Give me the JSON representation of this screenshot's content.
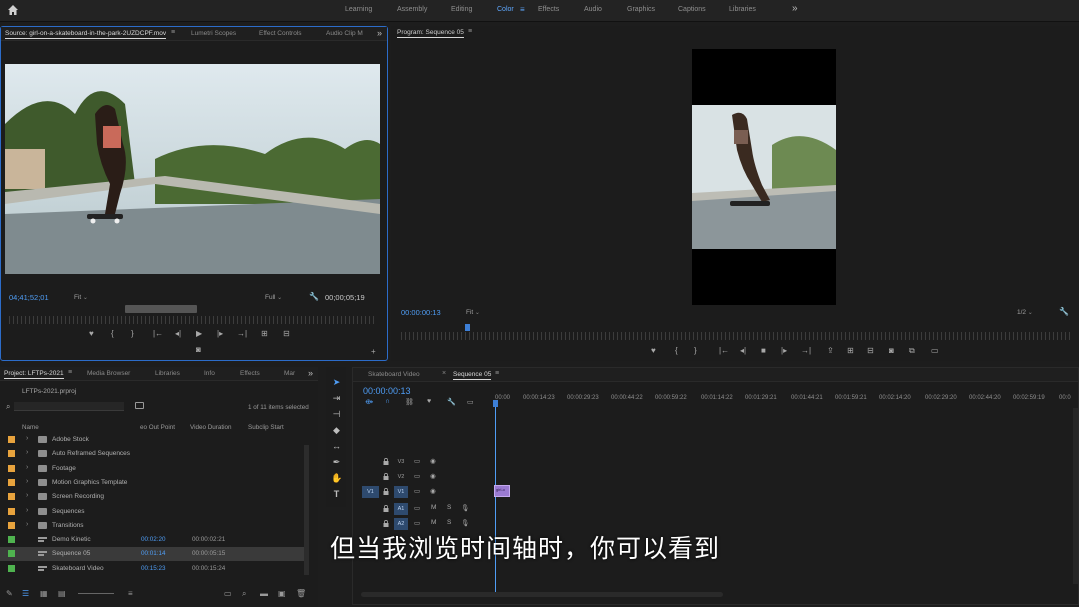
{
  "workspaces": {
    "tabs": [
      "Learning",
      "Assembly",
      "Editing",
      "Color",
      "Effects",
      "Audio",
      "Graphics",
      "Captions",
      "Libraries"
    ],
    "active": "Color",
    "more": "»"
  },
  "source": {
    "tabs": [
      "Source: girl-on-a-skateboard-in-the-park-2UZDCPF.mov",
      "Lumetri Scopes",
      "Effect Controls",
      "Audio Clip M"
    ],
    "timecode": "04;41;52;01",
    "fit": "Fit",
    "resolution": "Full",
    "duration": "00;00;05;19"
  },
  "program": {
    "tab": "Program: Sequence 05",
    "timecode": "00:00:00:13",
    "fit": "Fit",
    "resolution": "1/2"
  },
  "project": {
    "tabs": [
      "Project: LFTPs-2021",
      "Media Browser",
      "Libraries",
      "Info",
      "Effects",
      "Mar"
    ],
    "file": "LFTPs-2021.prproj",
    "selection_count": "1 of 11 items selected",
    "columns": [
      "Name",
      "eo Out Point",
      "Video Duration",
      "Subclip Start"
    ],
    "rows": [
      {
        "name": "Adobe Stock",
        "type": "folder",
        "color": "#e8a33d",
        "out": "",
        "dur": ""
      },
      {
        "name": "Auto Reframed Sequences",
        "type": "folder",
        "color": "#e8a33d",
        "out": "",
        "dur": ""
      },
      {
        "name": "Footage",
        "type": "folder",
        "color": "#e8a33d",
        "out": "",
        "dur": ""
      },
      {
        "name": "Motion Graphics Template",
        "type": "folder",
        "color": "#e8a33d",
        "out": "",
        "dur": ""
      },
      {
        "name": "Screen Recording",
        "type": "folder",
        "color": "#e8a33d",
        "out": "",
        "dur": ""
      },
      {
        "name": "Sequences",
        "type": "folder",
        "color": "#e8a33d",
        "out": "",
        "dur": ""
      },
      {
        "name": "Transitions",
        "type": "folder",
        "color": "#e8a33d",
        "out": "",
        "dur": ""
      },
      {
        "name": "Demo Kinetic",
        "type": "sequence",
        "color": "#4fb34f",
        "out": "00:02:20",
        "dur": "00:00:02:21"
      },
      {
        "name": "Sequence 05",
        "type": "sequence",
        "color": "#4fb34f",
        "out": "00:01:14",
        "dur": "00:00:05:15"
      },
      {
        "name": "Skateboard Video",
        "type": "sequence",
        "color": "#4fb34f",
        "out": "00:15:23",
        "dur": "00:00:15:24"
      }
    ]
  },
  "timeline": {
    "tabs": [
      "Skateboard Video",
      "Sequence 05"
    ],
    "active_tab": "Sequence 05",
    "timecode": "00:00:00:13",
    "ruler": [
      "00:00",
      "00:00:14:23",
      "00:00:29:23",
      "00:00:44:22",
      "00:00:59:22",
      "00:01:14:22",
      "00:01:29:21",
      "00:01:44:21",
      "00:01:59:21",
      "00:02:14:20",
      "00:02:29:20",
      "00:02:44:20",
      "00:02:59:19",
      "00:0"
    ],
    "tracks": [
      {
        "name": "V3",
        "target": ""
      },
      {
        "name": "V2",
        "target": ""
      },
      {
        "name": "V1",
        "target": "V1"
      },
      {
        "name": "A1",
        "target": ""
      },
      {
        "name": "A2",
        "target": ""
      }
    ],
    "clip_label": "girl-o"
  },
  "subtitle": "但当我浏览时间轴时，你可以看到"
}
